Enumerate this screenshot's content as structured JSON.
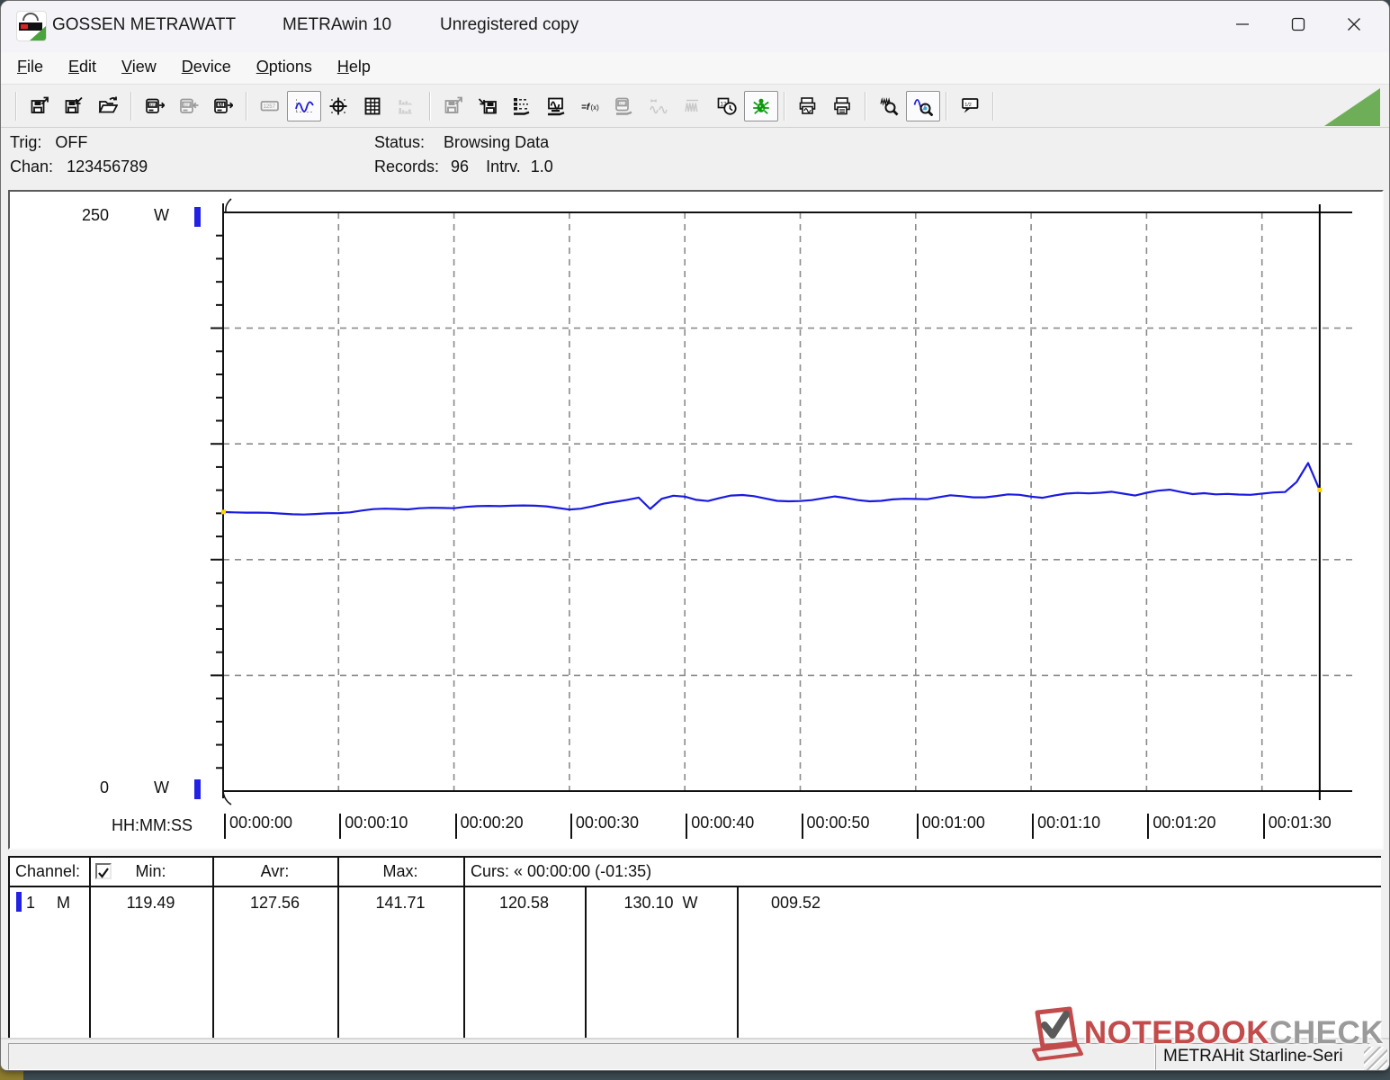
{
  "window": {
    "app_title": "GOSSEN METRAWATT",
    "product": "METRAwin 10",
    "license": "Unregistered copy",
    "controls": [
      "minimize",
      "maximize",
      "close"
    ]
  },
  "menu": [
    "File",
    "Edit",
    "View",
    "Device",
    "Options",
    "Help"
  ],
  "toolbar": {
    "items": [
      {
        "name": "separator"
      },
      {
        "name": "save-as",
        "state": "normal"
      },
      {
        "name": "save",
        "state": "normal"
      },
      {
        "name": "open-file",
        "state": "normal"
      },
      {
        "name": "separator"
      },
      {
        "name": "device-read",
        "state": "normal"
      },
      {
        "name": "device-stop",
        "state": "disabled"
      },
      {
        "name": "device-memory",
        "state": "normal"
      },
      {
        "name": "separator"
      },
      {
        "name": "numeric-display",
        "state": "disabled"
      },
      {
        "name": "chart-view",
        "state": "pressed"
      },
      {
        "name": "xy-view",
        "state": "normal"
      },
      {
        "name": "table-view",
        "state": "normal"
      },
      {
        "name": "histogram-view",
        "state": "disabled"
      },
      {
        "name": "separator"
      },
      {
        "name": "export",
        "state": "disabled"
      },
      {
        "name": "import-data",
        "state": "normal"
      },
      {
        "name": "channel-list",
        "state": "normal"
      },
      {
        "name": "monitor",
        "state": "normal"
      },
      {
        "name": "formula",
        "state": "normal"
      },
      {
        "name": "device-config",
        "state": "disabled"
      },
      {
        "name": "analog-out",
        "state": "disabled"
      },
      {
        "name": "pulse-out",
        "state": "disabled"
      },
      {
        "name": "scheduler",
        "state": "normal"
      },
      {
        "name": "debug",
        "state": "pressed"
      },
      {
        "name": "separator"
      },
      {
        "name": "print-preview",
        "state": "normal"
      },
      {
        "name": "print",
        "state": "normal"
      },
      {
        "name": "separator"
      },
      {
        "name": "zoom-all",
        "state": "normal"
      },
      {
        "name": "zoom-wave",
        "state": "pressed"
      },
      {
        "name": "separator"
      },
      {
        "name": "note",
        "state": "normal"
      },
      {
        "name": "separator"
      }
    ]
  },
  "status_panel": {
    "trig_label": "Trig:",
    "trig_value": "OFF",
    "chan_label": "Chan:",
    "chan_value": "123456789",
    "status_label": "Status:",
    "status_value": "Browsing Data",
    "records_label": "Records:",
    "records_value": "96",
    "interval_label": "Intrv.",
    "interval_value": "1.0"
  },
  "chart_data": {
    "type": "line",
    "title": "Power measurement trace, channel 1",
    "x_axis_label": "HH:MM:SS",
    "x_ticks": [
      {
        "label": "00:00:00",
        "t": 0
      },
      {
        "label": "00:00:10",
        "t": 10
      },
      {
        "label": "00:00:20",
        "t": 20
      },
      {
        "label": "00:00:30",
        "t": 30
      },
      {
        "label": "00:00:40",
        "t": 40
      },
      {
        "label": "00:00:50",
        "t": 50
      },
      {
        "label": "00:01:00",
        "t": 60
      },
      {
        "label": "00:01:10",
        "t": 70
      },
      {
        "label": "00:01:20",
        "t": 80
      },
      {
        "label": "00:01:30",
        "t": 90
      }
    ],
    "ylim": [
      0,
      250
    ],
    "y_max_label": "250",
    "y_min_label": "0",
    "y_unit": "W",
    "grid_y_values": [
      50,
      100,
      150,
      200
    ],
    "grid": true,
    "records": 96,
    "interval_s": 1.0,
    "series": [
      {
        "name": "Channel 1",
        "unit": "W",
        "color": "#1a1ae0",
        "values": [
          120.58,
          120.4,
          120.3,
          120.3,
          120.2,
          119.9,
          119.6,
          119.49,
          119.7,
          120.0,
          120.1,
          120.4,
          121.2,
          121.8,
          122.0,
          121.9,
          121.7,
          122.2,
          122.4,
          122.3,
          122.2,
          122.8,
          123.1,
          123.2,
          123.1,
          123.3,
          123.4,
          123.3,
          123.0,
          122.3,
          121.6,
          122.0,
          123.0,
          124.2,
          125.0,
          125.8,
          126.8,
          121.9,
          126.3,
          127.6,
          127.2,
          125.8,
          125.3,
          126.6,
          127.7,
          127.9,
          127.4,
          126.4,
          125.4,
          125.2,
          125.3,
          125.7,
          126.5,
          127.3,
          126.6,
          125.7,
          125.2,
          125.4,
          126.0,
          126.3,
          126.2,
          126.1,
          127.0,
          127.8,
          127.4,
          126.9,
          126.9,
          127.5,
          128.2,
          128.0,
          127.2,
          126.7,
          127.7,
          128.5,
          128.8,
          128.6,
          128.9,
          129.3,
          128.5,
          127.7,
          128.9,
          129.8,
          130.2,
          129.2,
          128.3,
          128.7,
          128.2,
          128.4,
          128.1,
          128.0,
          128.5,
          129.0,
          129.2,
          133.5,
          141.71,
          130.1
        ]
      }
    ],
    "cursor": {
      "label": "« 00:00:00 (-01:35)",
      "left_value": 120.58,
      "right_value": 130.1,
      "delta": 9.52,
      "right_t": 95
    }
  },
  "table": {
    "header": {
      "channel": "Channel:",
      "checkbox_checked": true,
      "min": "Min:",
      "avr": "Avr:",
      "max": "Max:",
      "curs": "Curs: « 00:00:00 (-01:35)"
    },
    "rows": [
      {
        "channel": "1",
        "mode": "M",
        "color": "#2222e6",
        "min": "119.49",
        "avr": "127.56",
        "max": "141.71",
        "curs_left": "120.58",
        "curs_right": "130.10",
        "unit": "W",
        "delta": "009.52"
      }
    ]
  },
  "statusbar": {
    "device": "METRAHit Starline-Seri"
  },
  "watermark": {
    "part1": "NOTEBOOK",
    "part2": "CHECK"
  }
}
